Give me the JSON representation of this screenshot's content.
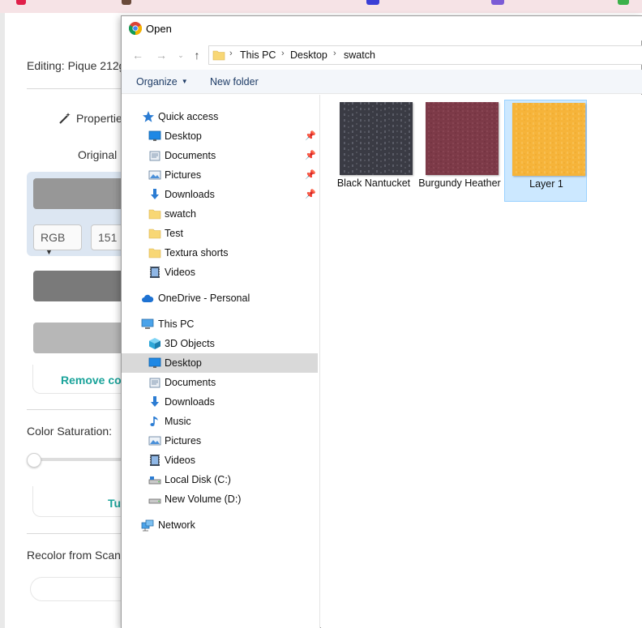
{
  "app": {
    "editing_label": "Editing: Pique 212g",
    "properties_label": "Propertie",
    "original_label": "Original",
    "color_mode": "RGB",
    "color_value": "151",
    "remove_color_label": "Remove col",
    "saturation_label": "Color Saturation:",
    "saturation_level": 0,
    "truncated_button_label": "Tu",
    "recolor_label": "Recolor from Scan"
  },
  "dialog": {
    "title": "Open",
    "breadcrumb": [
      "This PC",
      "Desktop",
      "swatch"
    ],
    "toolbar": {
      "organize": "Organize",
      "new_folder": "New folder"
    },
    "nav": {
      "quick_access": {
        "label": "Quick access",
        "items": [
          {
            "label": "Desktop",
            "icon": "desktop-icon",
            "pinned": true
          },
          {
            "label": "Documents",
            "icon": "documents-icon",
            "pinned": true
          },
          {
            "label": "Pictures",
            "icon": "pictures-icon",
            "pinned": true
          },
          {
            "label": "Downloads",
            "icon": "downloads-icon",
            "pinned": true
          },
          {
            "label": "swatch",
            "icon": "folder-icon",
            "pinned": false
          },
          {
            "label": "Test",
            "icon": "folder-icon",
            "pinned": false
          },
          {
            "label": "Textura shorts",
            "icon": "folder-icon",
            "pinned": false
          },
          {
            "label": "Videos",
            "icon": "videos-icon",
            "pinned": false
          }
        ]
      },
      "onedrive": {
        "label": "OneDrive - Personal"
      },
      "this_pc": {
        "label": "This PC",
        "items": [
          {
            "label": "3D Objects",
            "icon": "3d-objects-icon"
          },
          {
            "label": "Desktop",
            "icon": "desktop-icon",
            "selected": true
          },
          {
            "label": "Documents",
            "icon": "documents-icon"
          },
          {
            "label": "Downloads",
            "icon": "downloads-icon"
          },
          {
            "label": "Music",
            "icon": "music-icon"
          },
          {
            "label": "Pictures",
            "icon": "pictures-icon"
          },
          {
            "label": "Videos",
            "icon": "videos-icon"
          },
          {
            "label": "Local Disk (C:)",
            "icon": "drive-icon"
          },
          {
            "label": "New Volume (D:)",
            "icon": "drive-icon"
          }
        ]
      },
      "network": {
        "label": "Network"
      }
    },
    "files": [
      {
        "name": "Black Nantucket",
        "color": "#3a3b44",
        "selected": false
      },
      {
        "name": "Burgundy Heather",
        "color": "#7d3a48",
        "selected": false
      },
      {
        "name": "Layer 1",
        "color": "#f6b43a",
        "selected": true
      }
    ]
  },
  "colors": {
    "accent_teal": "#1aa39a",
    "selection_blue": "#cce8ff",
    "nav_selected": "#d9d9d9"
  }
}
